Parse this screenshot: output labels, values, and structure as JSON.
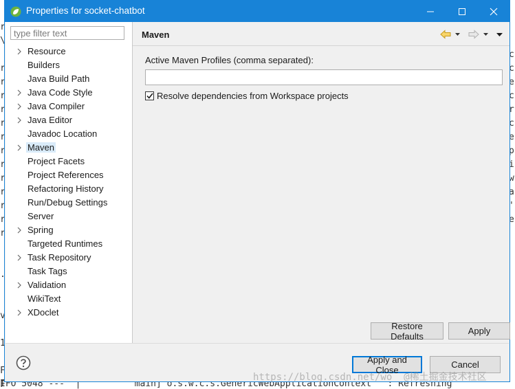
{
  "window": {
    "title": "Properties for socket-chatbot"
  },
  "filter": {
    "placeholder": "type filter text"
  },
  "tree": [
    {
      "label": "Resource",
      "expandable": true
    },
    {
      "label": "Builders",
      "expandable": false
    },
    {
      "label": "Java Build Path",
      "expandable": false
    },
    {
      "label": "Java Code Style",
      "expandable": true
    },
    {
      "label": "Java Compiler",
      "expandable": true
    },
    {
      "label": "Java Editor",
      "expandable": true
    },
    {
      "label": "Javadoc Location",
      "expandable": false
    },
    {
      "label": "Maven",
      "expandable": true,
      "selected": true
    },
    {
      "label": "Project Facets",
      "expandable": false
    },
    {
      "label": "Project References",
      "expandable": false
    },
    {
      "label": "Refactoring History",
      "expandable": false
    },
    {
      "label": "Run/Debug Settings",
      "expandable": false
    },
    {
      "label": "Server",
      "expandable": false
    },
    {
      "label": "Spring",
      "expandable": true
    },
    {
      "label": "Targeted Runtimes",
      "expandable": false
    },
    {
      "label": "Task Repository",
      "expandable": true
    },
    {
      "label": "Task Tags",
      "expandable": false
    },
    {
      "label": "Validation",
      "expandable": true
    },
    {
      "label": "WikiText",
      "expandable": false
    },
    {
      "label": "XDoclet",
      "expandable": true
    }
  ],
  "page": {
    "title": "Maven",
    "profiles_label": "Active Maven Profiles (comma separated):",
    "profiles_value": "",
    "resolve_label": "Resolve dependencies from Workspace projects",
    "resolve_checked": true
  },
  "buttons": {
    "restore_defaults": "Restore Defaults",
    "apply": "Apply",
    "apply_close": "Apply and Close",
    "cancel": "Cancel"
  },
  "background": {
    "left_column": [
      "r",
      "\\",
      "",
      "r",
      "r",
      "r",
      "r",
      "r",
      "r",
      "r",
      "r",
      "r",
      "r",
      "r",
      "r",
      "r",
      "",
      "",
      ".",
      "",
      "",
      "v",
      "",
      "1",
      "",
      "F",
      "F",
      "F"
    ],
    "right_column": [
      "c",
      "c",
      "e",
      "c",
      "r",
      "c",
      "e",
      "p",
      "i",
      "w",
      "a",
      "'",
      "e"
    ],
    "bottom_line": "IFO 5048 ---  |          main] o.s.w.c.s.GenericWebApplicationContext   : Refreshing",
    "watermark": "https://blog.csdn.net/wo  @稀土掘金技术社区"
  },
  "colors": {
    "titlebar": "#1883d7",
    "selection": "#d9ebf9",
    "default_button_border": "#0078d7"
  }
}
